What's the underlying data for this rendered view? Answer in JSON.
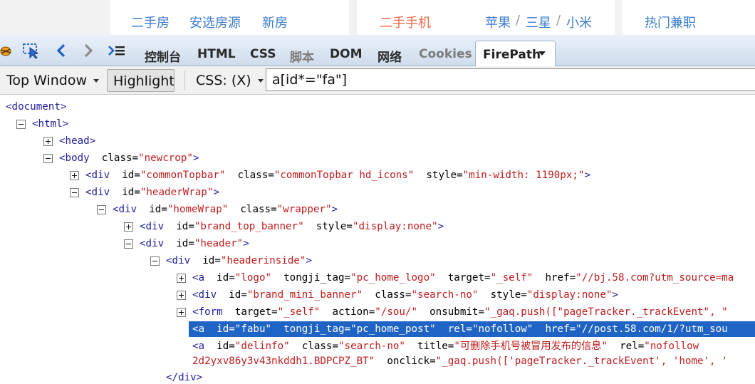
{
  "site_header": {
    "col1": [
      "二手房",
      "安选房源",
      "新房"
    ],
    "col2_hot": "二手手机",
    "col2_brands": [
      "苹果",
      "三星",
      "小米"
    ],
    "brand_sep": "/",
    "col3": "热门兼职"
  },
  "firebug": {
    "tool_icons": [
      "firebug-icon",
      "inspect-icon",
      "back-icon",
      "forward-icon",
      "command-line-icon"
    ],
    "tabs": [
      "控制台",
      "HTML",
      "CSS",
      "脚本",
      "DOM",
      "网络",
      "Cookies"
    ],
    "active_tab": "FirePath"
  },
  "firepath": {
    "frame_select": "Top Window",
    "highlight_label": "Highlight",
    "selector_type": "CSS: (X)",
    "query_value": "a[id*=\"fa\"]"
  },
  "tree": {
    "rows": [
      {
        "toggle": "",
        "parts": [
          [
            "tag",
            "<document>"
          ]
        ]
      },
      {
        "toggle": "minus",
        "parts": [
          [
            "tag",
            "<html>"
          ]
        ]
      },
      {
        "toggle": "plus",
        "parts": [
          [
            "tag",
            "<head>"
          ]
        ]
      },
      {
        "toggle": "minus",
        "parts": [
          [
            "tag",
            "<body  "
          ],
          [
            "attr",
            "class="
          ],
          [
            "val",
            "\"newcrop\""
          ],
          [
            "tag",
            ">"
          ]
        ]
      },
      {
        "toggle": "plus",
        "parts": [
          [
            "tag",
            "<div  "
          ],
          [
            "attr",
            "id="
          ],
          [
            "val",
            "\"commonTopbar\""
          ],
          [
            "attr",
            "  class="
          ],
          [
            "val",
            "\"commonTopbar hd_icons\""
          ],
          [
            "attr",
            "  style="
          ],
          [
            "val",
            "\"min-width: 1190px;\""
          ],
          [
            "tag",
            ">"
          ]
        ]
      },
      {
        "toggle": "minus",
        "parts": [
          [
            "tag",
            "<div  "
          ],
          [
            "attr",
            "id="
          ],
          [
            "val",
            "\"headerWrap\""
          ],
          [
            "tag",
            ">"
          ]
        ]
      },
      {
        "toggle": "minus",
        "parts": [
          [
            "tag",
            "<div  "
          ],
          [
            "attr",
            "id="
          ],
          [
            "val",
            "\"homeWrap\""
          ],
          [
            "attr",
            "  class="
          ],
          [
            "val",
            "\"wrapper\""
          ],
          [
            "tag",
            ">"
          ]
        ]
      },
      {
        "toggle": "plus",
        "parts": [
          [
            "tag",
            "<div  "
          ],
          [
            "attr",
            "id="
          ],
          [
            "val",
            "\"brand_top_banner\""
          ],
          [
            "attr",
            "  style="
          ],
          [
            "val",
            "\"display:none\""
          ],
          [
            "tag",
            ">"
          ]
        ]
      },
      {
        "toggle": "minus",
        "parts": [
          [
            "tag",
            "<div  "
          ],
          [
            "attr",
            "id="
          ],
          [
            "val",
            "\"header\""
          ],
          [
            "tag",
            ">"
          ]
        ]
      },
      {
        "toggle": "minus",
        "parts": [
          [
            "tag",
            "<div  "
          ],
          [
            "attr",
            "id="
          ],
          [
            "val",
            "\"headerinside\""
          ],
          [
            "tag",
            ">"
          ]
        ]
      },
      {
        "toggle": "plus",
        "parts": [
          [
            "tag",
            "<a  "
          ],
          [
            "attr",
            "id="
          ],
          [
            "val",
            "\"logo\""
          ],
          [
            "attr",
            "  tongji_tag="
          ],
          [
            "val",
            "\"pc_home_logo\""
          ],
          [
            "attr",
            "  target="
          ],
          [
            "val",
            "\"_self\""
          ],
          [
            "attr",
            "  href="
          ],
          [
            "val",
            "\"//bj.58.com?utm_source=ma"
          ]
        ]
      },
      {
        "toggle": "plus",
        "parts": [
          [
            "tag",
            "<div  "
          ],
          [
            "attr",
            "id="
          ],
          [
            "val",
            "\"brand_mini_banner\""
          ],
          [
            "attr",
            "  class="
          ],
          [
            "val",
            "\"search-no\""
          ],
          [
            "attr",
            "  style="
          ],
          [
            "val",
            "\"display:none\""
          ],
          [
            "tag",
            ">"
          ]
        ]
      },
      {
        "toggle": "plus",
        "parts": [
          [
            "tag",
            "<form  "
          ],
          [
            "attr",
            "target="
          ],
          [
            "val",
            "\"_self\""
          ],
          [
            "attr",
            "  action="
          ],
          [
            "val",
            "\"/sou/\""
          ],
          [
            "attr",
            "  onsubmit="
          ],
          [
            "val",
            "\"_gaq.push([\"pageTracker._trackEvent\", \""
          ]
        ]
      },
      {
        "toggle": "",
        "selected": true,
        "parts": [
          [
            "tag",
            "<a  "
          ],
          [
            "attr",
            "id="
          ],
          [
            "val",
            "\"fabu\""
          ],
          [
            "attr",
            "  tongji_tag="
          ],
          [
            "val",
            "\"pc_home_post\""
          ],
          [
            "attr",
            "  rel="
          ],
          [
            "val",
            "\"nofollow\""
          ],
          [
            "attr",
            "  href="
          ],
          [
            "val",
            "\"//post.58.com/1/?utm_sou"
          ]
        ]
      },
      {
        "toggle": "",
        "parts": [
          [
            "tag",
            "<a  "
          ],
          [
            "attr",
            "id="
          ],
          [
            "val",
            "\"delinfo\""
          ],
          [
            "attr",
            "  class="
          ],
          [
            "val",
            "\"search-no\""
          ],
          [
            "attr",
            "  title="
          ],
          [
            "val",
            "\"可删除手机号被冒用发布的信息\""
          ],
          [
            "attr",
            "  rel="
          ],
          [
            "val",
            "\"nofollow"
          ]
        ]
      },
      {
        "toggle": "",
        "parts": [
          [
            "val",
            "2d2yxv86y3v43nkddh1.BDPCPZ_BT\""
          ],
          [
            "attr",
            "  onclick="
          ],
          [
            "val",
            "\"_gaq.push(['pageTracker._trackEvent', 'home', '"
          ]
        ]
      },
      {
        "toggle": "",
        "parts": [
          [
            "tag",
            "</div>"
          ]
        ]
      }
    ]
  }
}
